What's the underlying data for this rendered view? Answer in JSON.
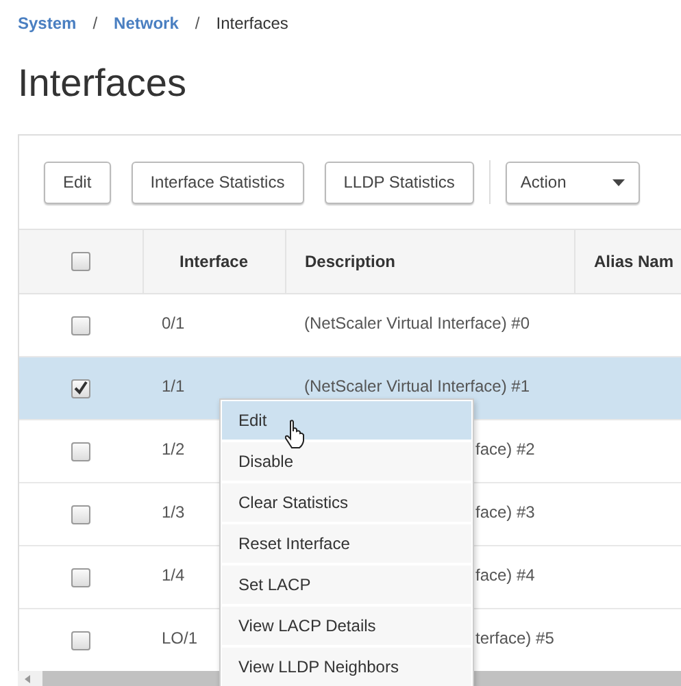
{
  "breadcrumb": {
    "separator": "/",
    "items": [
      {
        "label": "System",
        "link": true
      },
      {
        "label": "Network",
        "link": true
      },
      {
        "label": "Interfaces",
        "link": false
      }
    ]
  },
  "title": "Interfaces",
  "toolbar": {
    "buttons": [
      {
        "label": "Edit"
      },
      {
        "label": "Interface Statistics"
      },
      {
        "label": "LLDP Statistics"
      }
    ],
    "dropdown": {
      "label": "Action"
    }
  },
  "table": {
    "header_checkbox": {
      "checked": false
    },
    "columns": [
      {
        "label": "Interface"
      },
      {
        "label": "Description"
      },
      {
        "label": "Alias Nam"
      }
    ],
    "rows": [
      {
        "selected": false,
        "checked": false,
        "interface": "0/1",
        "description": "(NetScaler Virtual Interface) #0",
        "under_menu": false
      },
      {
        "selected": true,
        "checked": true,
        "interface": "1/1",
        "description": "(NetScaler Virtual Interface) #1",
        "under_menu": false
      },
      {
        "selected": false,
        "checked": false,
        "interface": "1/2",
        "description": "face) #2",
        "under_menu": true
      },
      {
        "selected": false,
        "checked": false,
        "interface": "1/3",
        "description": "face) #3",
        "under_menu": true
      },
      {
        "selected": false,
        "checked": false,
        "interface": "1/4",
        "description": "face) #4",
        "under_menu": true
      },
      {
        "selected": false,
        "checked": false,
        "interface": "LO/1",
        "description": "terface) #5",
        "under_menu": true
      }
    ]
  },
  "context_menu": {
    "items": [
      {
        "label": "Edit",
        "selected": true
      },
      {
        "label": "Disable",
        "selected": false
      },
      {
        "label": "Clear Statistics",
        "selected": false
      },
      {
        "label": "Reset Interface",
        "selected": false
      },
      {
        "label": "Set LACP",
        "selected": false
      },
      {
        "label": "View LACP Details",
        "selected": false
      },
      {
        "label": "View LLDP Neighbors",
        "selected": false
      }
    ]
  }
}
